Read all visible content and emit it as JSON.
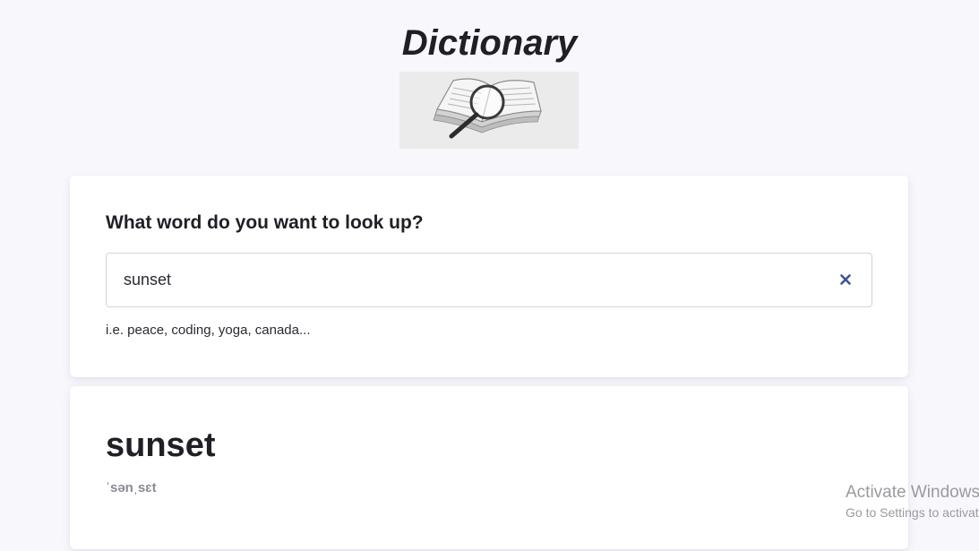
{
  "app": {
    "title": "Dictionary",
    "logo_icon": "book-magnifier-icon"
  },
  "search": {
    "heading": "What word do you want to look up?",
    "value": "sunset",
    "clear_icon": "close-icon",
    "hint": "i.e. peace, coding, yoga, canada..."
  },
  "result": {
    "word": "sunset",
    "phonetic": "ˈsənˌsɛt"
  },
  "watermark": {
    "title": "Activate Windows",
    "subtitle": "Go to Settings to activate Windows."
  },
  "colors": {
    "background": "#f8f7fc",
    "card": "#ffffff",
    "clear_icon": "#3b5591",
    "phonetic": "#8a8a92"
  }
}
